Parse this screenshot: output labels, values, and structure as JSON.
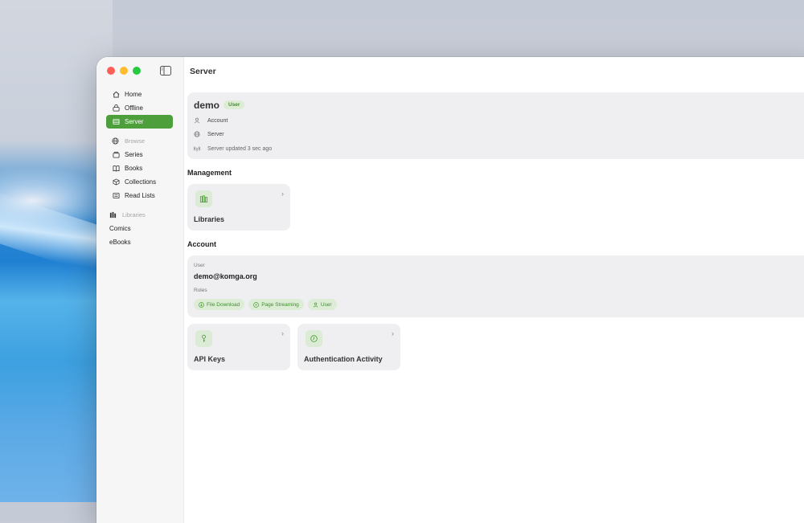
{
  "page_title": "Server",
  "sidebar": {
    "top_items": [
      {
        "label": "Home",
        "icon": "house-icon",
        "active": false
      },
      {
        "label": "Offline",
        "icon": "offline-icon",
        "active": false
      },
      {
        "label": "Server",
        "icon": "server-icon",
        "active": true
      }
    ],
    "browse_section": "Browse",
    "browse_items": [
      {
        "label": "Series",
        "icon": "series-icon"
      },
      {
        "label": "Books",
        "icon": "book-icon"
      },
      {
        "label": "Collections",
        "icon": "collections-icon"
      },
      {
        "label": "Read Lists",
        "icon": "list-icon"
      }
    ],
    "libraries_section": "Libraries",
    "library_items": [
      "Comics",
      "eBooks"
    ]
  },
  "server_card": {
    "username": "demo",
    "user_badge": "User",
    "account_label": "Account",
    "server_label": "Server",
    "status_text": "Server updated 3 sec ago"
  },
  "management": {
    "title": "Management",
    "tiles": [
      {
        "label": "Libraries",
        "icon": "libraries-icon"
      }
    ]
  },
  "account": {
    "title": "Account",
    "user_label": "User",
    "email": "demo@komga.org",
    "roles_label": "Roles",
    "roles": [
      {
        "label": "File Download",
        "icon": "download-icon"
      },
      {
        "label": "Page Streaming",
        "icon": "play-icon"
      },
      {
        "label": "User",
        "icon": "person-icon"
      }
    ],
    "tiles": [
      {
        "label": "API Keys",
        "icon": "key-icon"
      },
      {
        "label": "Authentication Activity",
        "icon": "clock-icon"
      }
    ]
  },
  "colors": {
    "accent": "#4c9f3a",
    "badge_bg": "#dcecd5",
    "card_bg": "#efeff2"
  }
}
